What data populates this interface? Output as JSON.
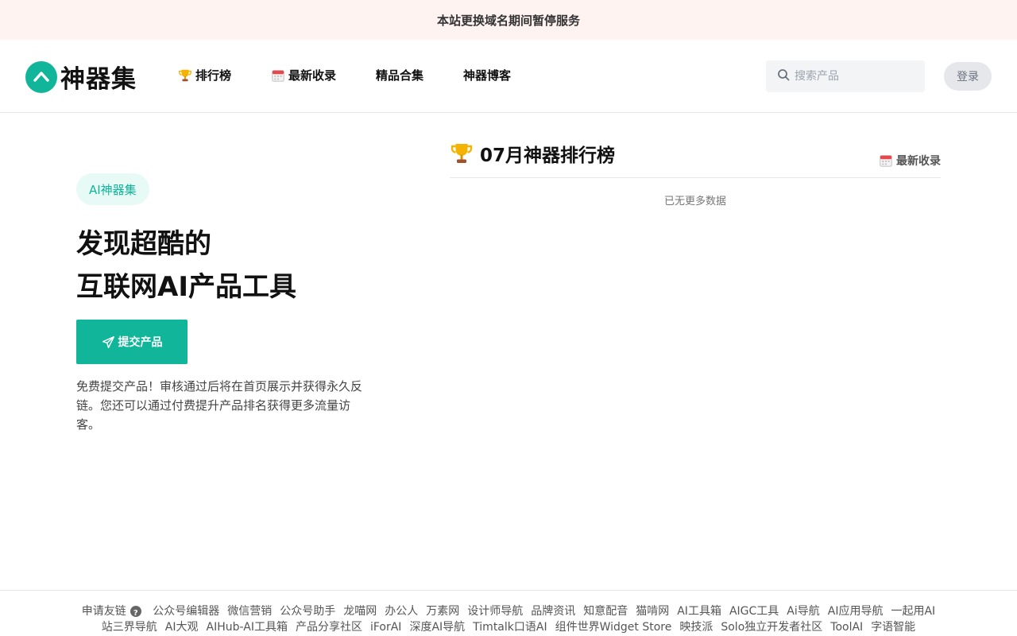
{
  "announcement": "本站更换域名期间暂停服务",
  "brand": {
    "name": "神器集",
    "color": "#10b59a"
  },
  "nav": [
    {
      "label": "排行榜",
      "icon": "trophy-icon"
    },
    {
      "label": "最新收录",
      "icon": "calendar-icon"
    },
    {
      "label": "精品合集"
    },
    {
      "label": "神器博客"
    }
  ],
  "search": {
    "placeholder": "搜索产品"
  },
  "login_label": "登录",
  "hero": {
    "badge": "AI神器集",
    "headline_line1": "发现超酷的",
    "headline_line2": "互联网AI产品工具",
    "submit_label": "提交产品",
    "description": "免费提交产品！审核通过后将在首页展示并获得永久反链。您还可以通过付费提升产品排名获得更多流量访客。"
  },
  "ranking": {
    "title": "07月神器排行榜",
    "latest_link": "最新收录",
    "empty_text": "已无更多数据"
  },
  "footer": {
    "friend_link_label": "申请友链",
    "links": [
      "公众号编辑器",
      "微信营销",
      "公众号助手",
      "龙喵网",
      "办公人",
      "万素网",
      "设计师导航",
      "品牌资讯",
      "知意配音",
      "猫啃网",
      "AI工具箱",
      "AIGC工具",
      "Ai导航",
      "AI应用导航",
      "一起用AI",
      "站三界导航",
      "AI大观",
      "AIHub-AI工具箱",
      "产品分享社区",
      "iForAI",
      "深度AI导航",
      "Timtalk口语AI",
      "组件世界Widget Store",
      "映技派",
      "Solo独立开发者社区",
      "ToolAI",
      "字语智能"
    ]
  }
}
